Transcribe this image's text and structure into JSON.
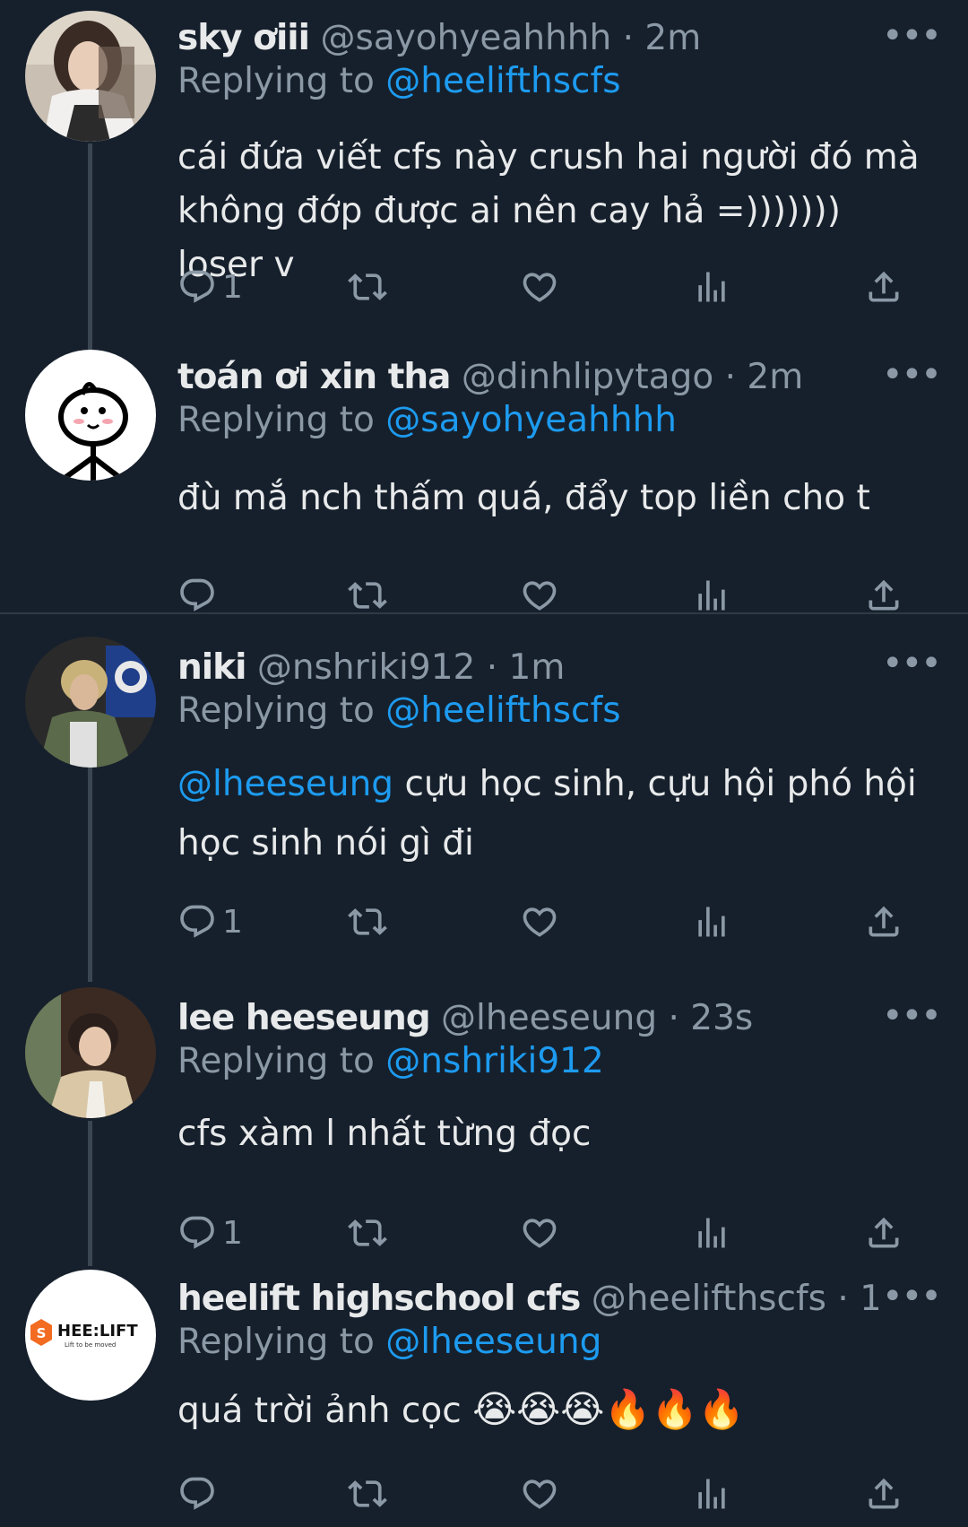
{
  "tweets": [
    {
      "name": "sky ơiii",
      "handle": "@sayohyeahhhh",
      "time": "2m",
      "replying_label": "Replying to ",
      "replying_to": "@heelifthscfs",
      "text_lines": [
        "cái đứa viết cfs này crush hai người đó mà",
        "không đớp được ai nên cay hả =))))))) loser v"
      ],
      "reply_count": "1"
    },
    {
      "name": "toán ơi xin tha",
      "handle": "@dinhlipytago",
      "time": "2m",
      "replying_label": "Replying to ",
      "replying_to": "@sayohyeahhhh",
      "text": "đù mắ nch thấm quá, đẩy top liền cho t",
      "reply_count": ""
    },
    {
      "name": "niki",
      "handle": "@nshriki912",
      "time": "1m",
      "replying_label": "Replying to ",
      "replying_to": "@heelifthscfs",
      "text_mention": "@lheeseung",
      "text_after_mention": " cựu học sinh, cựu hội phó hội",
      "text_line2": "học sinh nói gì đi",
      "reply_count": "1"
    },
    {
      "name": "lee heeseung",
      "handle": "@lheeseung",
      "time": "23s",
      "replying_label": "Replying to ",
      "replying_to": "@nshriki912",
      "text": "cfs xàm l nhất từng đọc",
      "reply_count": "1"
    },
    {
      "name": "heelift highschool cfs",
      "handle": "@heelifthscfs",
      "time": "10s",
      "replying_label": "Replying to ",
      "replying_to": "@lheeseung",
      "text": "quá trời ảnh cọc",
      "emojis": "😭😭😭🔥🔥🔥",
      "reply_count": ""
    }
  ],
  "separator_dot": "·",
  "more_glyph": "•••",
  "logo": {
    "brand": "HEE:LIFT",
    "tagline": "Lift to be moved"
  },
  "icons": [
    "reply-icon",
    "retweet-icon",
    "like-icon",
    "views-icon",
    "share-icon",
    "more-icon"
  ],
  "colors": {
    "background": "#16202c",
    "link": "#1d9bf0",
    "muted": "#8b98a5",
    "text": "#e7e9ea"
  }
}
